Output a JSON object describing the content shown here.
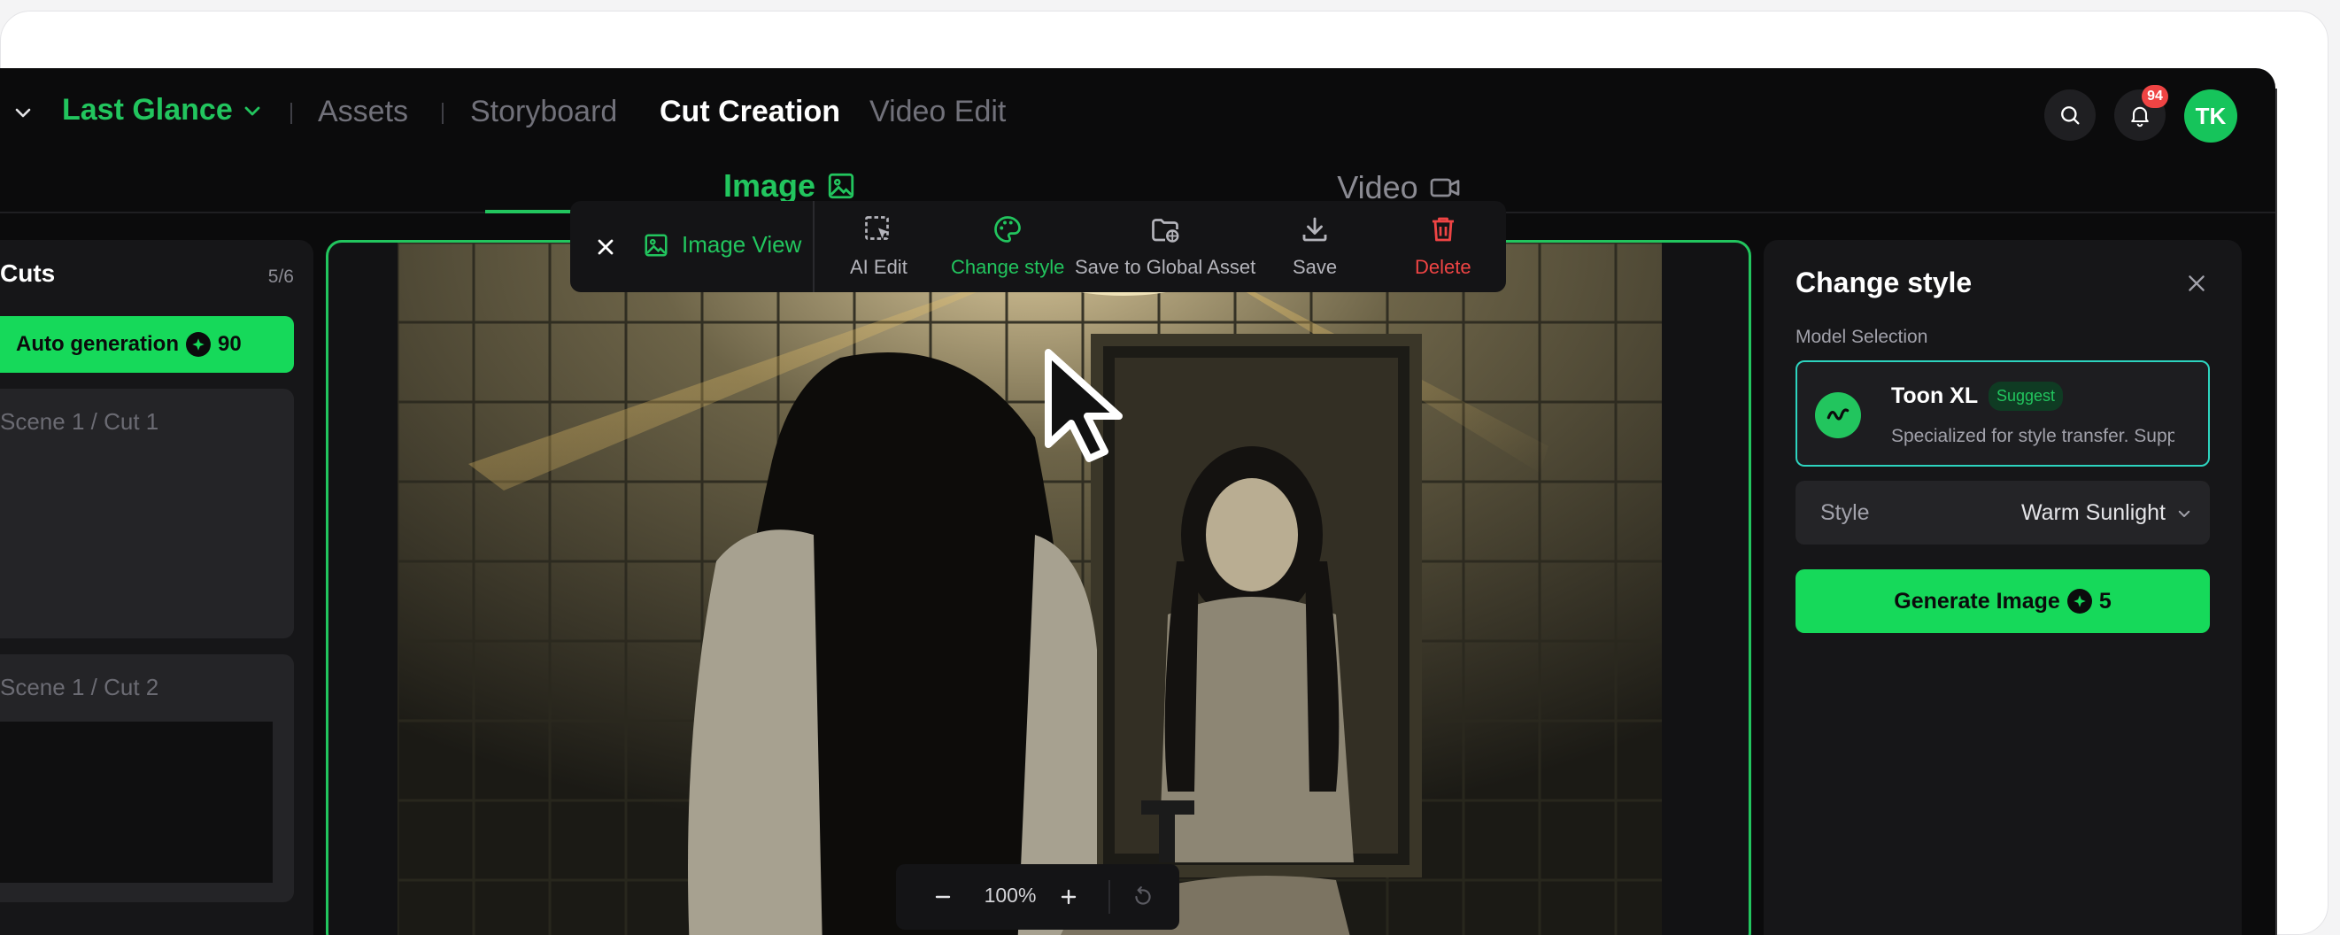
{
  "header": {
    "project_name": "Last Glance",
    "nav": [
      "Assets",
      "Storyboard",
      "Cut Creation",
      "Video Edit"
    ],
    "active_nav": "Cut Creation",
    "notifications_count": "94",
    "avatar_initials": "TK"
  },
  "tabs": {
    "image": "Image",
    "video": "Video",
    "active": "Image"
  },
  "cuts": {
    "title": "Cuts",
    "count": "5/6",
    "auto_generation_label": "Auto generation",
    "auto_generation_cost": "90",
    "items": [
      {
        "label": "Scene 1 / Cut 1"
      },
      {
        "label": "Scene 1 / Cut 2"
      }
    ]
  },
  "toolbar": {
    "view_label": "Image View",
    "items": [
      {
        "label": "AI Edit",
        "icon": "ai-edit-icon"
      },
      {
        "label": "Change style",
        "icon": "palette-icon"
      },
      {
        "label": "Save to Global Asset",
        "icon": "folder-globe-icon"
      },
      {
        "label": "Save",
        "icon": "download-icon"
      },
      {
        "label": "Delete",
        "icon": "trash-icon"
      }
    ],
    "active_item": "Change style"
  },
  "zoom": {
    "value": "100%"
  },
  "style_panel": {
    "title": "Change style",
    "model_selection_label": "Model Selection",
    "model": {
      "name": "Toon XL",
      "badge": "Suggest",
      "description": "Specialized for style transfer. Supp"
    },
    "style_label": "Style",
    "style_value": "Warm Sunlight",
    "generate_label": "Generate Image",
    "generate_cost": "5"
  },
  "colors": {
    "accent": "#22c55e",
    "danger": "#ef4444",
    "background": "#0b0b0c"
  }
}
